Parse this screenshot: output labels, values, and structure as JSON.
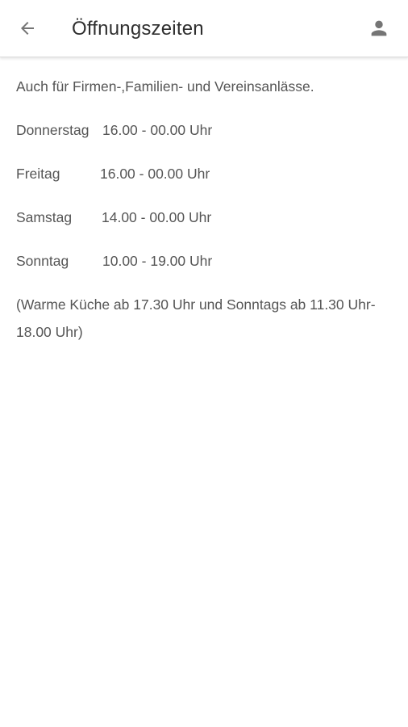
{
  "header": {
    "title": "Öffnungszeiten",
    "back_icon": "arrow-left-icon",
    "profile_icon": "person-icon",
    "icon_color": "#757575"
  },
  "content": {
    "intro": "Auch für Firmen-,Familien- und Vereinsanlässe.",
    "hours": [
      {
        "day": "Donnerstag",
        "time": "16.00 - 00.00 Uhr"
      },
      {
        "day": "Freitag",
        "time": "16.00 - 00.00 Uhr"
      },
      {
        "day": "Samstag",
        "time": "14.00 - 00.00 Uhr"
      },
      {
        "day": "Sonntag",
        "time": "10.00 - 19.00 Uhr"
      }
    ],
    "note": "(Warme Küche ab 17.30 Uhr und Sonntags ab 11.30 Uhr-18.00 Uhr)"
  }
}
